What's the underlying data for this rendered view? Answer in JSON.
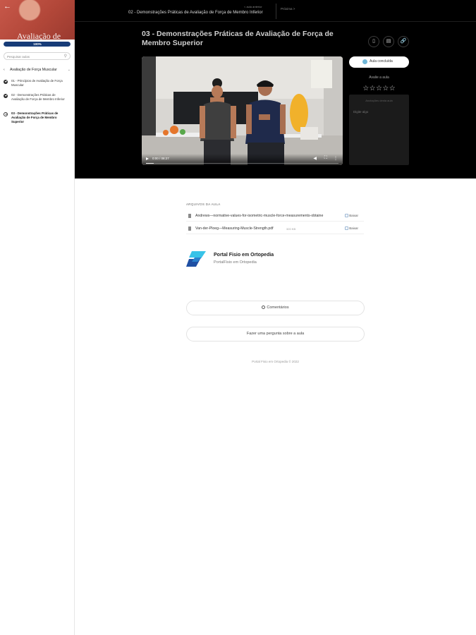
{
  "sidebar": {
    "back_icon": "arrow-left-icon",
    "course_title": "Avaliação de",
    "progress": {
      "percent": 100,
      "label": "100%"
    },
    "search": {
      "placeholder": "Pesquisar aulas",
      "icon": "search-icon"
    },
    "module": {
      "title": "Avaliação de Força Muscular",
      "expanded": true
    },
    "lessons": [
      {
        "label": "01 - Princípios de Avaliação de Força Muscular",
        "status": "done"
      },
      {
        "label": "02 - Demonstrações Práticas de Avaliação de Força de Membro Inferior",
        "status": "done"
      },
      {
        "label": "03 - Demonstrações Práticas de Avaliação de Força de Membro Superior",
        "status": "current"
      }
    ]
  },
  "topbar": {
    "prev_label": "< aula anterior",
    "prev_title": "02 - Demonstrações Práticas de Avaliação de Força de Membro Inferior",
    "next_label": "Próxima >"
  },
  "lesson": {
    "title": "03 - Demonstrações Práticas de Avaliação de Força de Membro Superior",
    "actions": [
      "bookmark-icon",
      "notes-icon",
      "link-icon"
    ]
  },
  "video": {
    "time": "0:00 / 08:27",
    "progress": 0.04
  },
  "side_panel": {
    "complete_label": "Aula concluída",
    "rating_label": "Avalie a aula",
    "stars": 5,
    "notes_header": "Anotações desta aula",
    "notes_placeholder": "Digite algo"
  },
  "files": {
    "heading": "ARQUIVOS DA AULA",
    "items": [
      {
        "name": "Andrews—normative-values-for-isometric-muscle-force-measurements-obtaine",
        "size": "",
        "action": "Baixar"
      },
      {
        "name": "Van-der-Ploeg—Measuring-Muscle-Strength.pdf",
        "size": "320 KB",
        "action": "Baixar"
      }
    ]
  },
  "instructor": {
    "name": "Portal Fisio em Ortopedia",
    "subtitle": "PortalFisio em Ortopedia"
  },
  "buttons": {
    "comments": "Comentários",
    "ask_question": "Fazer uma pergunta sobre a aula"
  },
  "footer": "Portal Fisio em Ortopedia © 2022",
  "colors": {
    "accent": "#173c78",
    "complete": "#6fb7d8",
    "banner": "#b24739"
  }
}
